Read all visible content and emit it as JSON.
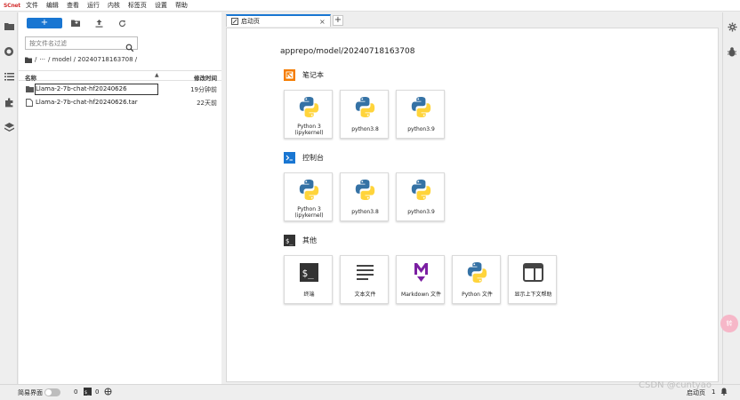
{
  "app": {
    "logo_text": "SCnet",
    "menu": [
      "文件",
      "编辑",
      "查看",
      "运行",
      "内核",
      "标签页",
      "设置",
      "帮助"
    ]
  },
  "filebrowser": {
    "new_label": "+",
    "search_placeholder": "按文件名过滤",
    "breadcrumb": [
      "/",
      "···",
      "/ model / 20240718163708 /"
    ],
    "columns": {
      "name": "名称",
      "modified": "修改时间"
    },
    "files": [
      {
        "name": "Llama-2-7b-chat-hf20240626",
        "modified": "19分钟前",
        "type": "folder"
      },
      {
        "name": "Llama-2-7b-chat-hf20240626.tar",
        "modified": "22天前",
        "type": "file"
      }
    ]
  },
  "tabs": [
    {
      "label": "启动页"
    }
  ],
  "launcher": {
    "path": "apprepo/model/20240718163708",
    "sections": [
      {
        "title": "笔记本",
        "icon": "notebook-icon",
        "color": "#f57c00",
        "items": [
          "Python 3 (ipykernel)",
          "python3.8",
          "python3.9"
        ]
      },
      {
        "title": "控制台",
        "icon": "console-icon",
        "color": "#1976d2",
        "items": [
          "Python 3 (ipykernel)",
          "python3.8",
          "python3.9"
        ]
      },
      {
        "title": "其他",
        "icon": "terminal-icon",
        "color": "#333333",
        "items": [
          "终端",
          "文本文件",
          "Markdown 文件",
          "Python 文件",
          "显示上下文帮助"
        ]
      }
    ]
  },
  "statusbar": {
    "simple_mode": "简易界面",
    "kernels_count": "0",
    "terminals_count": "0",
    "page_label": "启动页",
    "page_count": "1"
  },
  "float_button": "转",
  "watermark": "CSDN @cuntyao",
  "colors": {
    "accent": "#1976d2",
    "python_blue": "#3572A5",
    "python_yellow": "#FFD43B",
    "markdown": "#7b1fa2"
  }
}
